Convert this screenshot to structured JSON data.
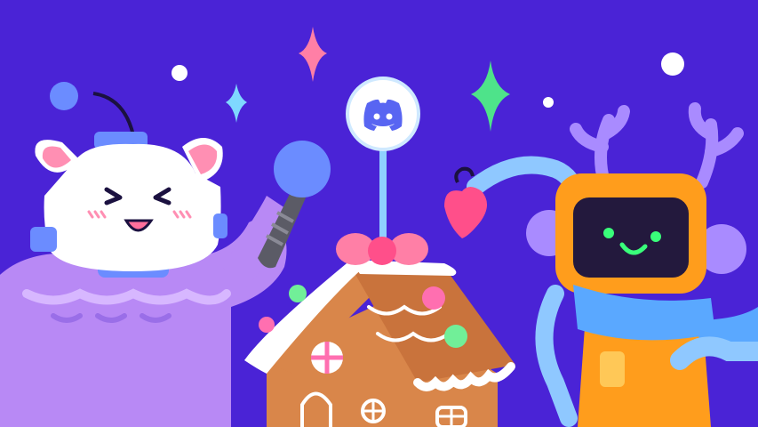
{
  "scene": {
    "background_color": "#4a23d6",
    "palette": {
      "sparkle_pink": "#ff7fa6",
      "sparkle_cyan": "#7fd8ff",
      "sparkle_green": "#4ee38a",
      "bear_white": "#ffffff",
      "sweater_purple": "#b889f5",
      "sweater_trim": "#d7b7ff",
      "helmet_blue": "#6b8cff",
      "robot_orange": "#ff9d1c",
      "robot_screen": "#23193d",
      "robot_face_green": "#39ff7a",
      "antler_lilac": "#a98bff",
      "scarf_blue": "#5aa8ff",
      "gingerbread": "#d9864a",
      "icing": "#ffffff",
      "candy_pink": "#ff6fb0",
      "candy_green": "#71ef98"
    },
    "icons": [
      "discord-logo-icon",
      "sparkle-icon",
      "star-dot-icon"
    ]
  }
}
